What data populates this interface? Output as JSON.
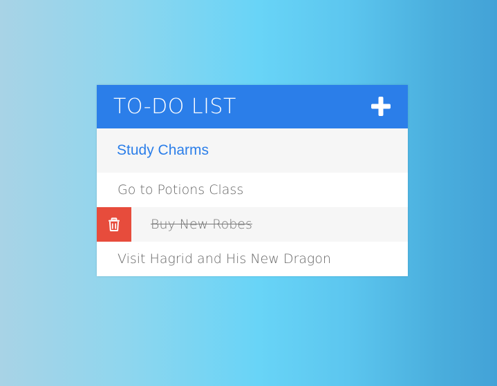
{
  "header": {
    "title": "TO-DO LIST",
    "add_icon": "plus-icon"
  },
  "new_todo": {
    "value": "Study Charms"
  },
  "todos": [
    {
      "text": "Go to Potions Class",
      "completed": false
    },
    {
      "text": "Buy New Robes",
      "completed": true,
      "delete_icon": "trash-icon"
    },
    {
      "text": "Visit Hagrid and His New Dragon",
      "completed": false
    }
  ],
  "colors": {
    "header_bg": "#2b7ee9",
    "input_text": "#2b7ee9",
    "delete_bg": "#e74c3c",
    "row_alt_bg": "#f6f6f6",
    "todo_text": "#666666"
  }
}
